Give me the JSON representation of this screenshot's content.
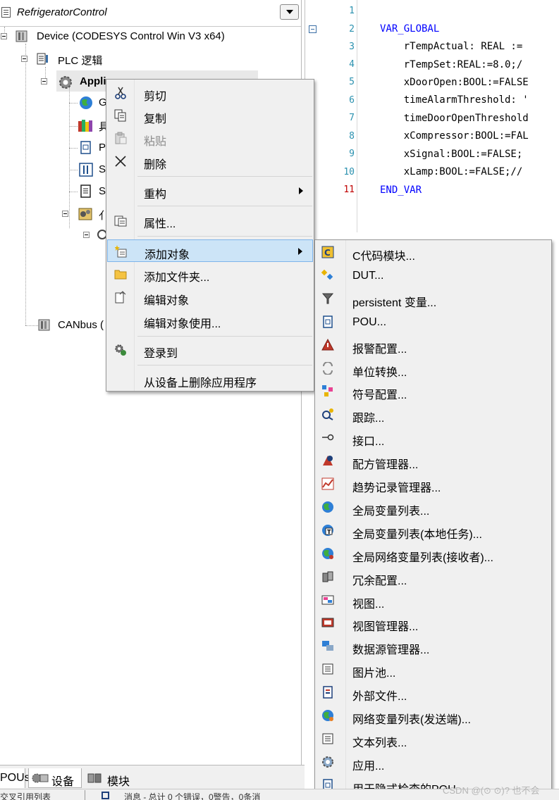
{
  "tree": {
    "project_name": "RefrigeratorControl",
    "device_label": "Device (CODESYS Control Win V3 x64)",
    "plc_label": "PLC 逻辑",
    "application_label": "Appli",
    "truncated_labels": [
      "G",
      "具",
      "P",
      "S",
      "S",
      "亻"
    ],
    "canbus_label": "CANbus ("
  },
  "editor": {
    "line_numbers": [
      "1",
      "2",
      "3",
      "4",
      "5",
      "6",
      "7",
      "8",
      "9",
      "10",
      "11"
    ],
    "lines": [
      "",
      "VAR_GLOBAL",
      "    rTempActual: REAL :=",
      "    rTempSet:REAL:=8.0;/",
      "    xDoorOpen:BOOL:=FALSE",
      "    timeAlarmThreshold: '",
      "    timeDoorOpenThreshold",
      "    xCompressor:BOOL:=FAL",
      "    xSignal:BOOL:=FALSE;",
      "    xLamp:BOOL:=FALSE;//",
      "END_VAR"
    ]
  },
  "context_menu": {
    "items": [
      {
        "label": "剪切",
        "icon": "scissors-icon"
      },
      {
        "label": "复制",
        "icon": "copy-icon"
      },
      {
        "label": "粘贴",
        "icon": "paste-icon",
        "disabled": true
      },
      {
        "label": "删除",
        "icon": "delete-x-icon"
      },
      {
        "label": "重构",
        "icon": "none"
      },
      {
        "label": "属性...",
        "icon": "properties-icon"
      },
      {
        "label": "添加对象",
        "icon": "add-object-icon"
      },
      {
        "label": "添加文件夹...",
        "icon": "folder-icon"
      },
      {
        "label": "编辑对象",
        "icon": "edit-object-icon"
      },
      {
        "label": "编辑对象使用...",
        "icon": "none"
      },
      {
        "label": "登录到",
        "icon": "login-gears-icon"
      },
      {
        "label": "从设备上删除应用程序",
        "icon": "none"
      }
    ]
  },
  "submenu": {
    "items": [
      {
        "label": "C代码模块...",
        "icon": "c-code-icon"
      },
      {
        "label": "DUT...",
        "icon": "dut-icon"
      },
      {
        "label": "persistent 变量...",
        "icon": "persistent-var-icon"
      },
      {
        "label": "POU...",
        "icon": "pou-icon"
      },
      {
        "label": "报警配置...",
        "icon": "alarm-config-icon"
      },
      {
        "label": "单位转换...",
        "icon": "unit-conversion-icon"
      },
      {
        "label": "符号配置...",
        "icon": "symbol-config-icon"
      },
      {
        "label": "跟踪...",
        "icon": "trace-icon"
      },
      {
        "label": "接口...",
        "icon": "interface-icon"
      },
      {
        "label": "配方管理器...",
        "icon": "recipe-manager-icon"
      },
      {
        "label": "趋势记录管理器...",
        "icon": "trend-manager-icon"
      },
      {
        "label": "全局变量列表...",
        "icon": "globe-icon"
      },
      {
        "label": "全局变量列表(本地任务)...",
        "icon": "globe-task-icon"
      },
      {
        "label": "全局网络变量列表(接收者)...",
        "icon": "globe-network-icon"
      },
      {
        "label": "冗余配置...",
        "icon": "redundancy-icon"
      },
      {
        "label": "视图...",
        "icon": "visualization-icon"
      },
      {
        "label": "视图管理器...",
        "icon": "visualization-manager-icon"
      },
      {
        "label": "数据源管理器...",
        "icon": "datasource-manager-icon"
      },
      {
        "label": "图片池...",
        "icon": "image-pool-icon"
      },
      {
        "label": "外部文件...",
        "icon": "external-file-icon"
      },
      {
        "label": "网络变量列表(发送端)...",
        "icon": "network-var-list-icon"
      },
      {
        "label": "文本列表...",
        "icon": "text-list-icon"
      },
      {
        "label": "应用...",
        "icon": "application-gear-icon"
      },
      {
        "label": "用于隐式检查的POU...",
        "icon": "implicit-check-pou-icon"
      }
    ]
  },
  "bottom_tabs": {
    "pous": "POUs",
    "devices": "设备",
    "modules": "模块"
  },
  "status": {
    "left_text": "交叉引用列表",
    "messages_text": "消息 - 总计 0 个错误，0警告，0条消"
  },
  "watermark": "CSDN @(⊙ ⊙)? 也不会"
}
